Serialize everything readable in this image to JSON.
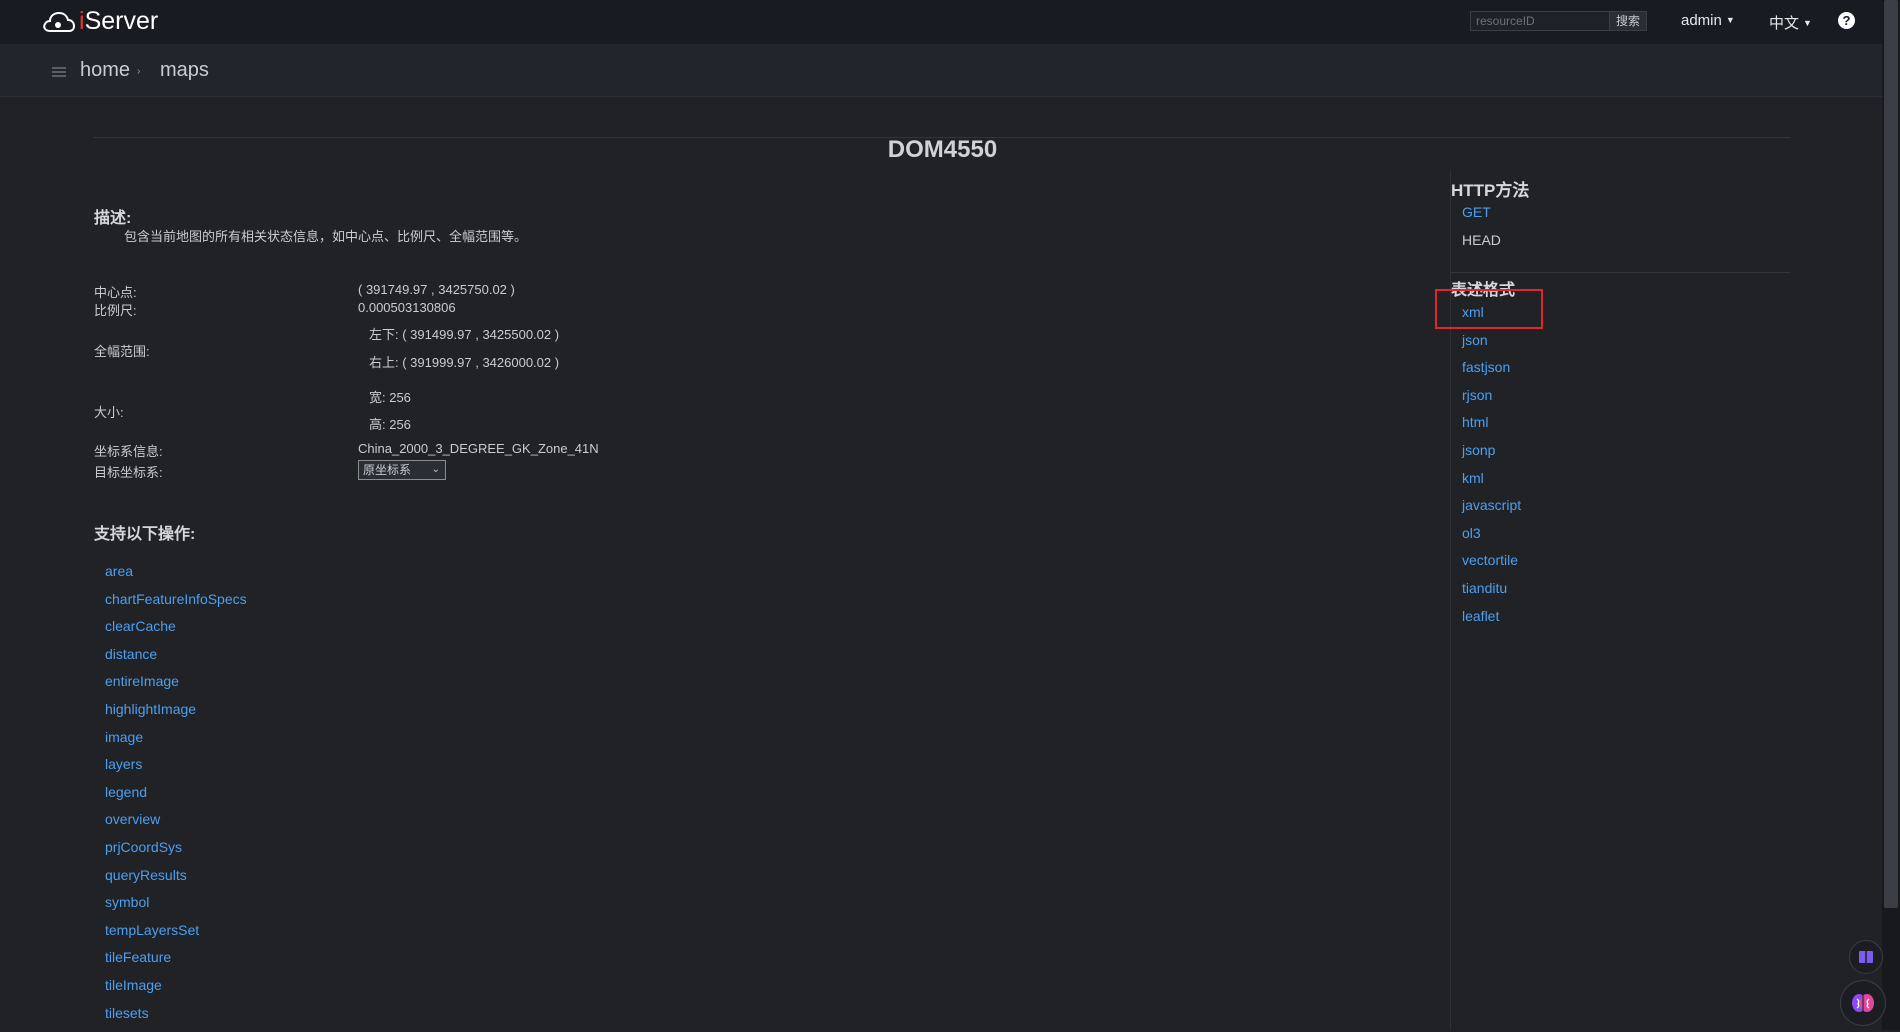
{
  "header": {
    "logo_text": "iServer",
    "search_placeholder": "resourceID",
    "search_button": "搜索",
    "user_menu": "admin",
    "language_menu": "中文",
    "help": "?"
  },
  "breadcrumb": {
    "home": "home",
    "separator": "›",
    "current": "maps"
  },
  "page": {
    "title": "DOM4550",
    "description_heading": "描述:",
    "description": "包含当前地图的所有相关状态信息，如中心点、比例尺、全幅范围等。",
    "center_label": "中心点:",
    "center_value": "( 391749.97 , 3425750.02 )",
    "scale_label": "比例尺:",
    "scale_value": "0.000503130806",
    "bounds_label": "全幅范围:",
    "bounds_lower_left": "左下:  ( 391499.97 , 3425500.02 )",
    "bounds_upper_right": "右上:  ( 391999.97 , 3426000.02 )",
    "size_label": "大小:",
    "size_width": "宽:  256",
    "size_height": "高:  256",
    "crs_label": "坐标系信息:",
    "crs_value": "China_2000_3_DEGREE_GK_Zone_41N",
    "target_crs_label": "目标坐标系:",
    "target_crs_selected": "原坐标系",
    "operations_heading": "支持以下操作:",
    "operations": [
      "area",
      "chartFeatureInfoSpecs",
      "clearCache",
      "distance",
      "entireImage",
      "highlightImage",
      "image",
      "layers",
      "legend",
      "overview",
      "prjCoordSys",
      "queryResults",
      "symbol",
      "tempLayersSet",
      "tileFeature",
      "tileImage",
      "tilesets"
    ]
  },
  "sidebar": {
    "http_heading": "HTTP方法",
    "methods": [
      "GET",
      "HEAD"
    ],
    "formats_heading": "表述格式",
    "formats": [
      "xml",
      "json",
      "fastjson",
      "rjson",
      "html",
      "jsonp",
      "kml",
      "javascript",
      "ol3",
      "vectortile",
      "tianditu",
      "leaflet"
    ]
  },
  "colors": {
    "background": "#202226",
    "topbar": "#181b22",
    "link": "#4d9ff0",
    "highlight": "#e0262c",
    "logo_accent": "#e0392b"
  },
  "icons": [
    "cloud-logo-icon",
    "help-icon",
    "breadcrumb-menu-icon",
    "book-icon",
    "brain-icon"
  ]
}
